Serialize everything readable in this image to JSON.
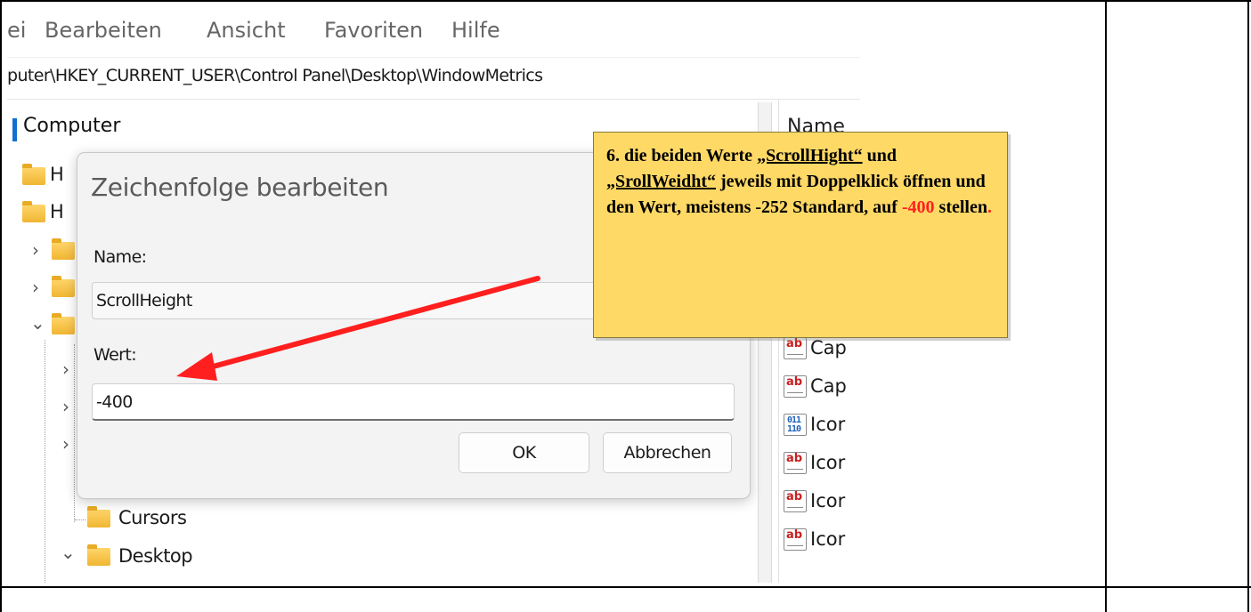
{
  "menu": {
    "items": [
      "ei",
      "Bearbeiten",
      "Ansicht",
      "Favoriten",
      "Hilfe"
    ]
  },
  "address": {
    "path": "puter\\HKEY_CURRENT_USER\\Control Panel\\Desktop\\WindowMetrics"
  },
  "tree": {
    "root_label": "Computer",
    "hidden_label_1": "H",
    "hidden_label_2": "H",
    "cursors_label": "Cursors",
    "desktop_label": "Desktop"
  },
  "values_pane": {
    "header": "Name",
    "rows": [
      {
        "icon": "string-value-icon",
        "label": "Cap"
      },
      {
        "icon": "string-value-icon",
        "label": "Cap"
      },
      {
        "icon": "binary-value-icon",
        "label": "Icor"
      },
      {
        "icon": "string-value-icon",
        "label": "Icor"
      },
      {
        "icon": "string-value-icon",
        "label": "Icor"
      },
      {
        "icon": "string-value-icon",
        "label": "Icor"
      }
    ]
  },
  "dialog": {
    "title": "Zeichenfolge bearbeiten",
    "name_label": "Name:",
    "name_value": "ScrollHeight",
    "value_label": "Wert:",
    "value_value": "-400",
    "ok_label": "OK",
    "cancel_label": "Abbrechen"
  },
  "callout": {
    "part1": "6. die beiden Werte ",
    "link1": "„ScrollHight“",
    "part2": " und ",
    "link2": "„SrollWeidht“",
    "part3": " jeweils mit Doppelklick öffnen und den Wert, meistens -252 Standard, auf ",
    "highlight": "-400",
    "part4": " stellen",
    "end": "."
  },
  "colors": {
    "callout_bg": "#ffd966",
    "arrow": "#ff1f1f",
    "highlight": "#ff1f1f",
    "selection_bar": "#1170cf"
  }
}
